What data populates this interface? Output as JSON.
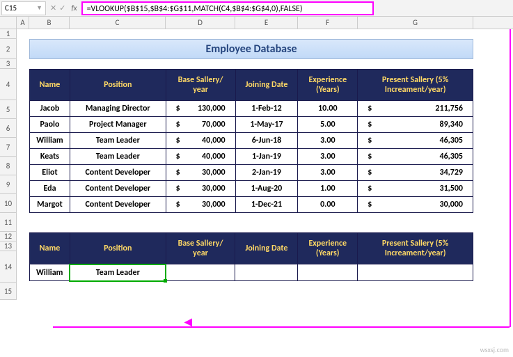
{
  "nameBox": "C15",
  "formula": "=VLOOKUP($B$15,$B$4:$G$11,MATCH(C4,$B$4:$G$4,0),FALSE)",
  "fx": "fx",
  "cols": [
    "A",
    "B",
    "C",
    "D",
    "E",
    "F",
    "G"
  ],
  "rows": [
    "1",
    "2",
    "3",
    "4",
    "5",
    "6",
    "7",
    "8",
    "9",
    "10",
    "11",
    "12",
    "13",
    "14",
    "15"
  ],
  "title": "Employee Database",
  "headers": {
    "name": "Name",
    "pos": "Position",
    "sal": "Base Sallery/ year",
    "date": "Joining Date",
    "exp": "Experience (Years)",
    "pres": "Present Sallery (5% Increament/year)"
  },
  "data": [
    {
      "name": "Jacob",
      "pos": "Managing Director",
      "sal": "130,000",
      "date": "1-Feb-12",
      "exp": "10.00",
      "pres": "211,756"
    },
    {
      "name": "Paolo",
      "pos": "Project Manager",
      "sal": "70,000",
      "date": "1-May-17",
      "exp": "5.00",
      "pres": "89,340"
    },
    {
      "name": "William",
      "pos": "Team Leader",
      "sal": "40,000",
      "date": "6-Jun-18",
      "exp": "3.00",
      "pres": "46,305"
    },
    {
      "name": "Keats",
      "pos": "Team Leader",
      "sal": "40,000",
      "date": "1-Jan-19",
      "exp": "3.00",
      "pres": "46,305"
    },
    {
      "name": "Eliot",
      "pos": "Content Developer",
      "sal": "30,000",
      "date": "2-Jan-19",
      "exp": "3.00",
      "pres": "34,729"
    },
    {
      "name": "Eda",
      "pos": "Content Developer",
      "sal": "30,000",
      "date": "1-Aug-20",
      "exp": "1.00",
      "pres": "31,500"
    },
    {
      "name": "Margot",
      "pos": "Content Developer",
      "sal": "30,000",
      "date": "1-Dec-21",
      "exp": "0.00",
      "pres": "30,000"
    }
  ],
  "lookup": {
    "name": "William",
    "pos": "Team Leader"
  },
  "currency": "$",
  "watermark": "wsxsj.com"
}
